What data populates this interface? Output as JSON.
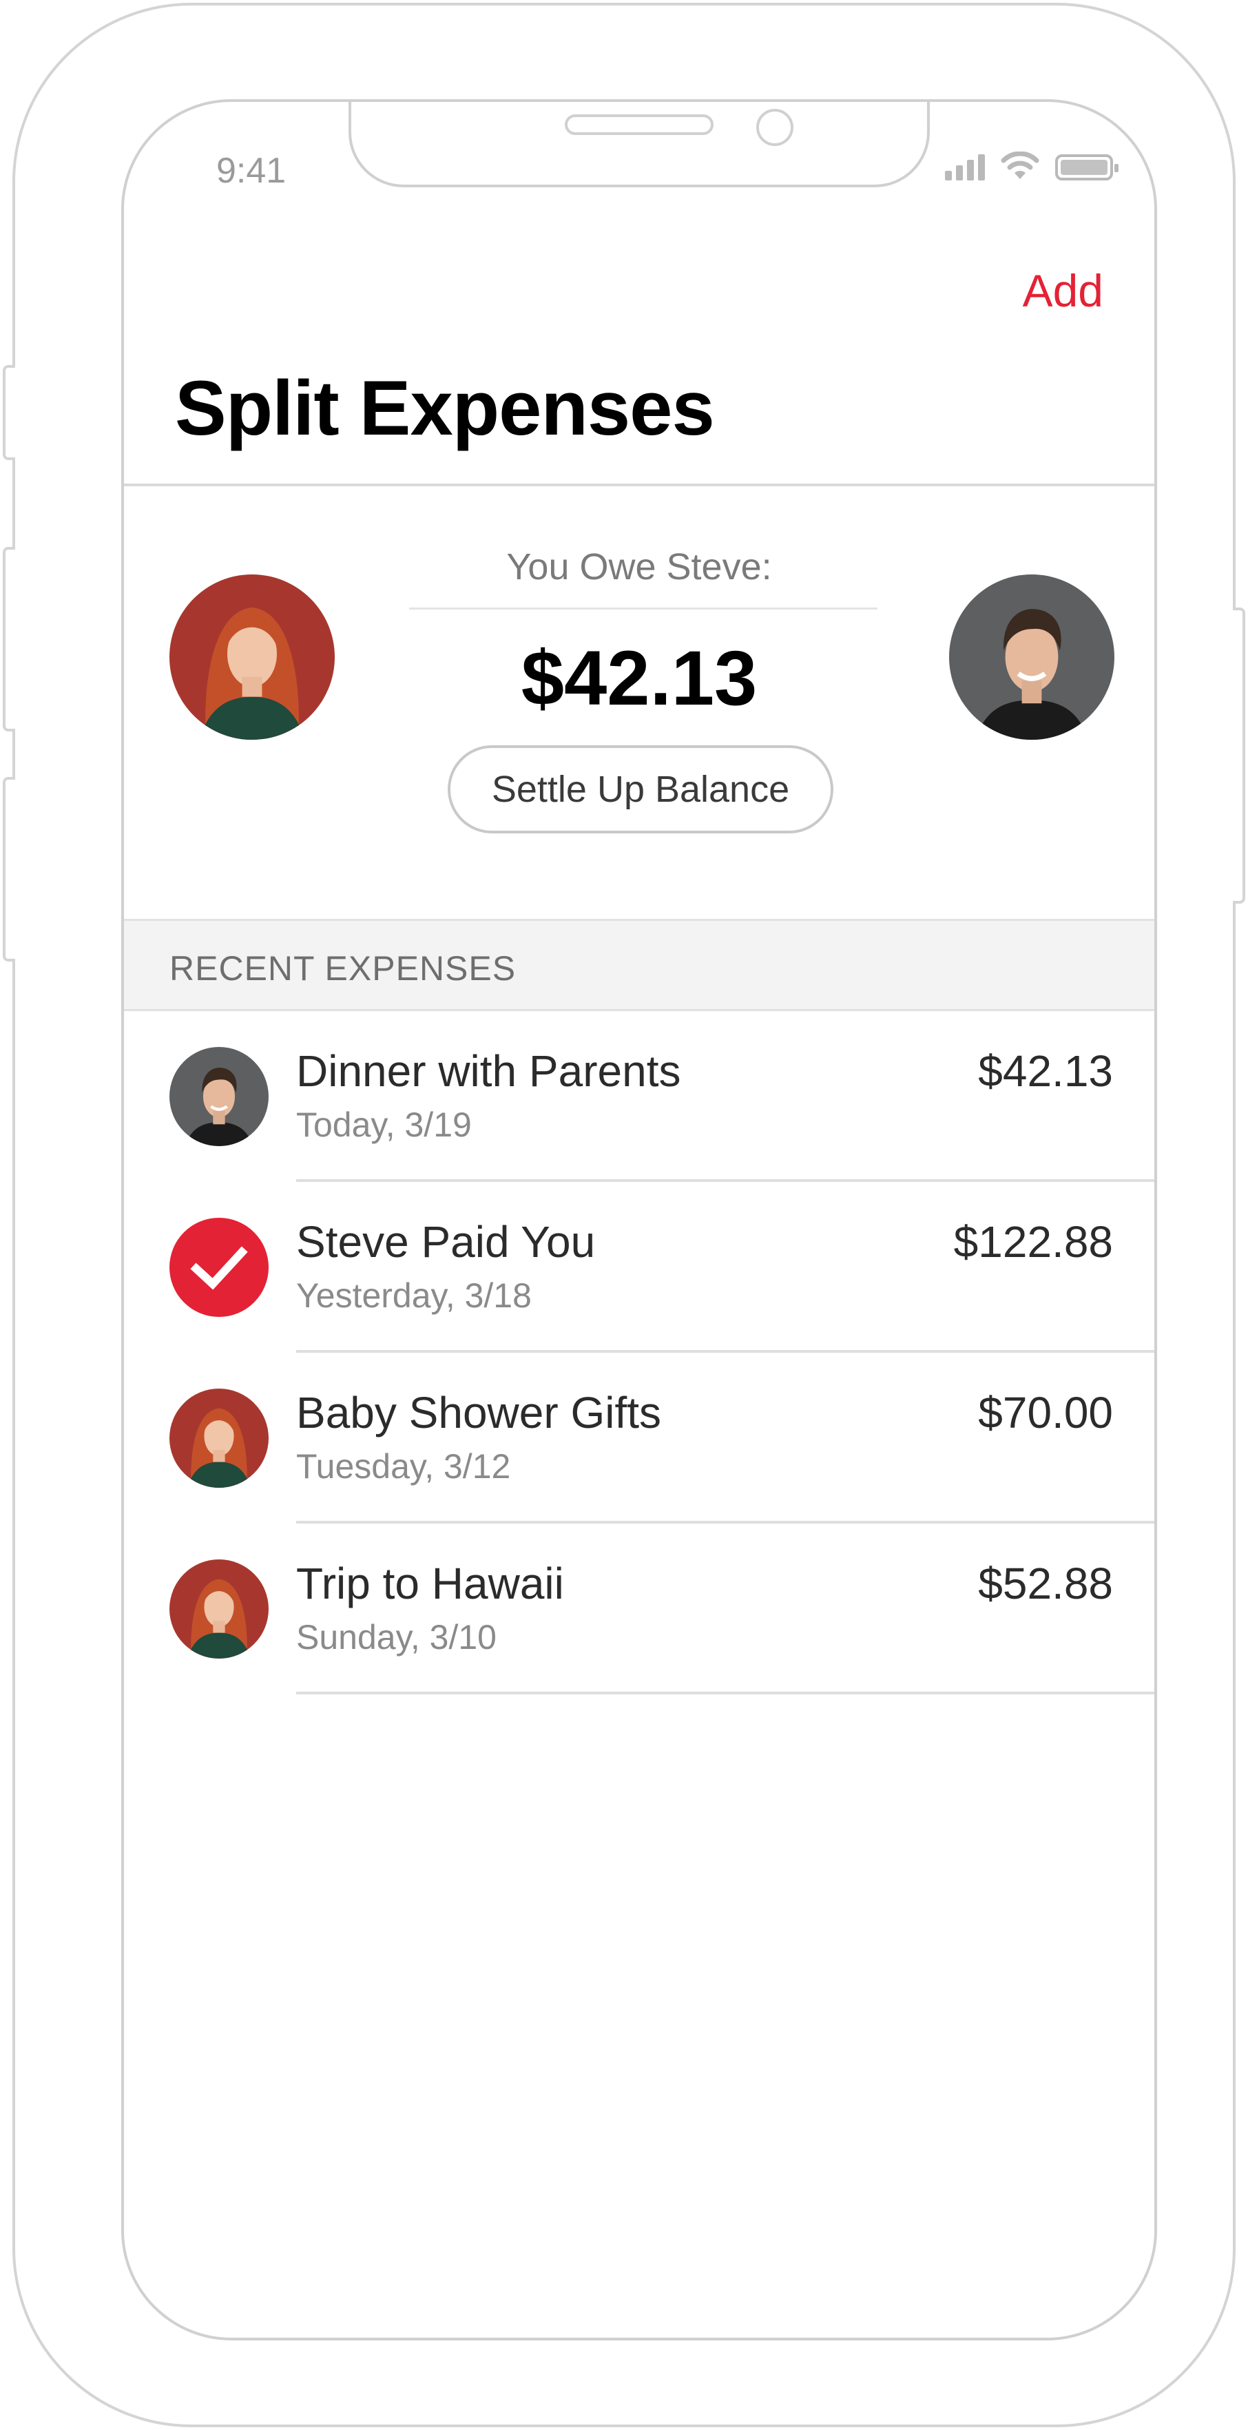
{
  "status_bar": {
    "time": "9:41"
  },
  "nav": {
    "add_label": "Add",
    "title": "Split Expenses"
  },
  "balance": {
    "label": "You Owe Steve:",
    "amount": "$42.13",
    "settle_label": "Settle Up Balance"
  },
  "recent": {
    "header": "RECENT EXPENSES",
    "items": [
      {
        "title": "Dinner with Parents",
        "date": "Today, 3/19",
        "amount": "$42.13",
        "icon": "steve-avatar"
      },
      {
        "title": "Steve Paid You",
        "date": "Yesterday, 3/18",
        "amount": "$122.88",
        "icon": "check-icon"
      },
      {
        "title": "Baby Shower Gifts",
        "date": "Tuesday, 3/12",
        "amount": "$70.00",
        "icon": "user-avatar"
      },
      {
        "title": "Trip to Hawaii",
        "date": "Sunday, 3/10",
        "amount": "$52.88",
        "icon": "user-avatar"
      }
    ]
  },
  "colors": {
    "accent": "#e42235",
    "divider": "#dedede",
    "section_bg": "#f3f3f3"
  }
}
